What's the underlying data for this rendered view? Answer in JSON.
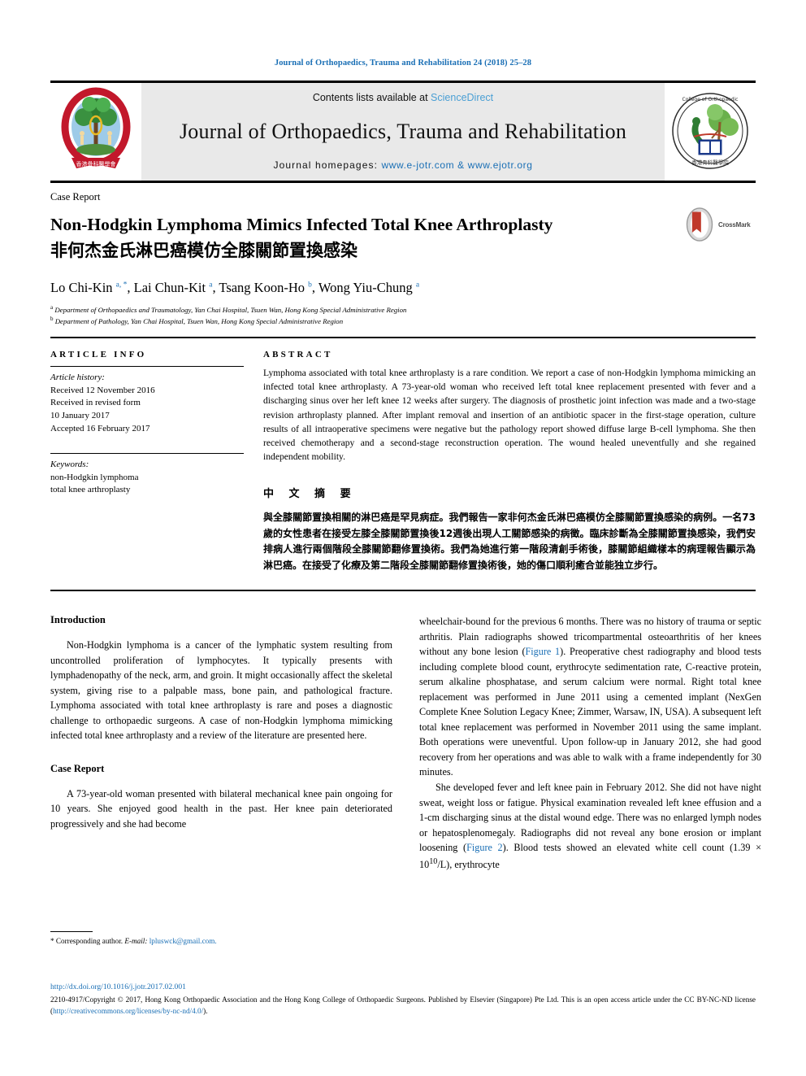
{
  "running_head": "Journal of Orthopaedics, Trauma and Rehabilitation 24 (2018) 25–28",
  "masthead": {
    "contents_prefix": "Contents lists available at ",
    "contents_link": "ScienceDirect",
    "journal_name": "Journal of Orthopaedics, Trauma and Rehabilitation",
    "homepages_label": "Journal homepages: ",
    "homepages_urls": "www.e-jotr.com & www.ejotr.org",
    "logo_left_name": "Hong Kong Orthopaedic Association emblem",
    "logo_right_name": "Hong Kong College of Orthopaedic Surgeons emblem"
  },
  "article": {
    "kicker": "Case Report",
    "title_en": "Non-Hodgkin Lymphoma Mimics Infected Total Knee Arthroplasty",
    "title_cn": "非何杰金氏淋巴癌模仿全膝關節置換感染",
    "authors": "Lo Chi-Kin a,*, Lai Chun-Kit a, Tsang Koon-Ho b, Wong Yiu-Chung a",
    "affiliation_a": "Department of Orthopaedics and Traumatology, Yan Chai Hospital, Tsuen Wan, Hong Kong Special Administrative Region",
    "affiliation_b": "Department of Pathology, Yan Chai Hospital, Tsuen Wan, Hong Kong Special Administrative Region",
    "crossmark_label": "CrossMark"
  },
  "article_info": {
    "heading": "ARTICLE INFO",
    "history_label": "Article history:",
    "received": "Received 12 November 2016",
    "revised_label": "Received in revised form",
    "revised_date": "10 January 2017",
    "accepted": "Accepted 16 February 2017",
    "keywords_label": "Keywords:",
    "keyword_1": "non-Hodgkin lymphoma",
    "keyword_2": "total knee arthroplasty"
  },
  "abstract": {
    "heading": "ABSTRACT",
    "text": "Lymphoma associated with total knee arthroplasty is a rare condition. We report a case of non-Hodgkin lymphoma mimicking an infected total knee arthroplasty. A 73-year-old woman who received left total knee replacement presented with fever and a discharging sinus over her left knee 12 weeks after surgery. The diagnosis of prosthetic joint infection was made and a two-stage revision arthroplasty planned. After implant removal and insertion of an antibiotic spacer in the first-stage operation, culture results of all intraoperative specimens were negative but the pathology report showed diffuse large B-cell lymphoma. She then received chemotherapy and a second-stage reconstruction operation. The wound healed uneventfully and she regained independent mobility.",
    "cn_heading": "中 文 摘 要",
    "cn_text": "與全膝關節置換相關的淋巴癌是罕見病症。我們報告一家非何杰金氏淋巴癌模仿全膝關節置換感染的病例。一名73歲的女性患者在接受左膝全膝關節置換後12週後出現人工關節感染的病徵。臨床診斷為全膝關節置換感染，我們安排病人進行兩個階段全膝關節翻修置換術。我們為她進行第一階段清創手術後，膝關節組織樣本的病理報告顯示為淋巴癌。在接受了化療及第二階段全膝關節翻修置換術後，她的傷口順利癒合並能独立步行。"
  },
  "body": {
    "intro_heading": "Introduction",
    "intro_p1": "Non-Hodgkin lymphoma is a cancer of the lymphatic system resulting from uncontrolled proliferation of lymphocytes. It typically presents with lymphadenopathy of the neck, arm, and groin. It might occasionally affect the skeletal system, giving rise to a palpable mass, bone pain, and pathological fracture. Lymphoma associated with total knee arthroplasty is rare and poses a diagnostic challenge to orthopaedic surgeons. A case of non-Hodgkin lymphoma mimicking infected total knee arthroplasty and a review of the literature are presented here.",
    "case_heading": "Case Report",
    "case_p1": "A 73-year-old woman presented with bilateral mechanical knee pain ongoing for 10 years. She enjoyed good health in the past. Her knee pain deteriorated progressively and she had become",
    "right_p1_a": "wheelchair-bound for the previous 6 months. There was no history of trauma or septic arthritis. Plain radiographs showed tricompartmental osteoarthritis of her knees without any bone lesion (",
    "right_p1_fig1": "Figure 1",
    "right_p1_b": "). Preoperative chest radiography and blood tests including complete blood count, erythrocyte sedimentation rate, C-reactive protein, serum alkaline phosphatase, and serum calcium were normal. Right total knee replacement was performed in June 2011 using a cemented implant (NexGen Complete Knee Solution Legacy Knee; Zimmer, Warsaw, IN, USA). A subsequent left total knee replacement was performed in November 2011 using the same implant. Both operations were uneventful. Upon follow-up in January 2012, she had good recovery from her operations and was able to walk with a frame independently for 30 minutes.",
    "right_p2_a": "She developed fever and left knee pain in February 2012. She did not have night sweat, weight loss or fatigue. Physical examination revealed left knee effusion and a 1-cm discharging sinus at the distal wound edge. There was no enlarged lymph nodes or hepatosplenomegaly. Radiographs did not reveal any bone erosion or implant loosening (",
    "right_p2_fig2": "Figure 2",
    "right_p2_b": "). Blood tests showed an elevated white cell count (1.39 × 10",
    "right_p2_sup": "10",
    "right_p2_c": "/L), erythrocyte",
    "corresponding_marker": "*",
    "corresponding_label": " Corresponding author. ",
    "corresponding_email_label": "E-mail:",
    "corresponding_email": "lpluswck@gmail.com."
  },
  "footer": {
    "doi": "http://dx.doi.org/10.1016/j.jotr.2017.02.001",
    "copyright_a": "2210-4917/Copyright © 2017, Hong Kong Orthopaedic Association and the Hong Kong College of Orthopaedic Surgeons. Published by Elsevier (Singapore) Pte Ltd. This is an open access article under the CC BY-NC-ND license (",
    "copyright_link": "http://creativecommons.org/licenses/by-nc-nd/4.0/",
    "copyright_b": ")."
  },
  "colors": {
    "link_blue": "#1a6fb5",
    "sciencedirect_blue": "#4a9fd4",
    "masthead_gray": "#e9e9e9",
    "crossmark_red": "#c0392b"
  }
}
